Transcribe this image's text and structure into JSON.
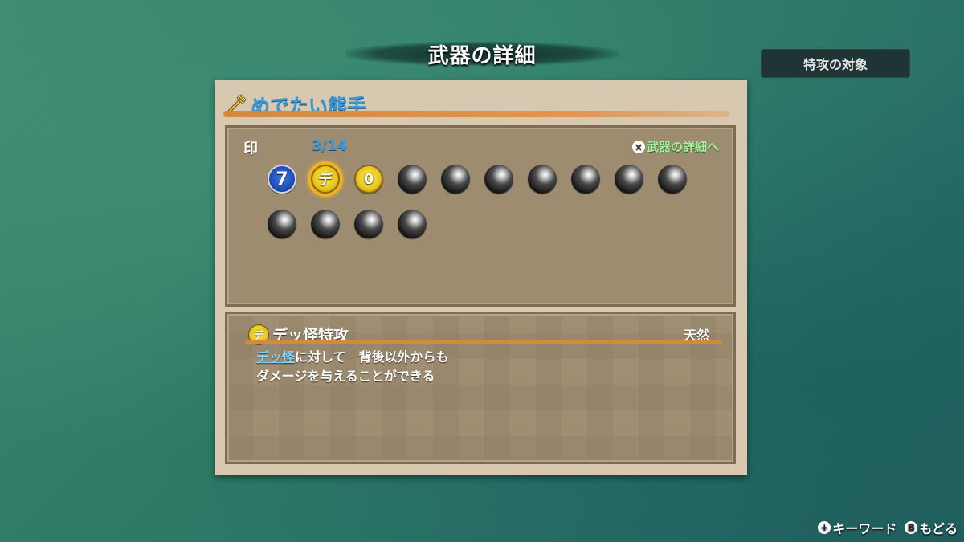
{
  "header": {
    "title": "武器の詳細"
  },
  "target_button": {
    "label": "特攻の対象"
  },
  "weapon": {
    "name": "めでたい熊手",
    "icon": "rake-icon"
  },
  "seals": {
    "label": "印",
    "count": "3/14",
    "detail_link": "武器の詳細へ",
    "detail_link_button": "×",
    "filled": [
      {
        "type": "blue",
        "glyph": "7",
        "selected": false
      },
      {
        "type": "yellow",
        "glyph": "デ",
        "selected": true
      },
      {
        "type": "yellow",
        "glyph": "0",
        "selected": false
      }
    ],
    "empty_count": 11
  },
  "skill": {
    "icon_glyph": "デ",
    "name": "デッ怪特攻",
    "type": "天然",
    "keyword": "デッ怪",
    "desc_line1_rest": "に対して　背後以外からも",
    "desc_line2": "ダメージを与えることができる"
  },
  "footer": {
    "keyword_button": "+",
    "keyword_label": "キーワード",
    "back_button": "B",
    "back_label": "もどる"
  },
  "colors": {
    "accent_blue": "#3a9ad8",
    "link_green": "#a8f0a0",
    "selected_ring": "#f0b020",
    "stroke_orange": "#d28a3c"
  }
}
